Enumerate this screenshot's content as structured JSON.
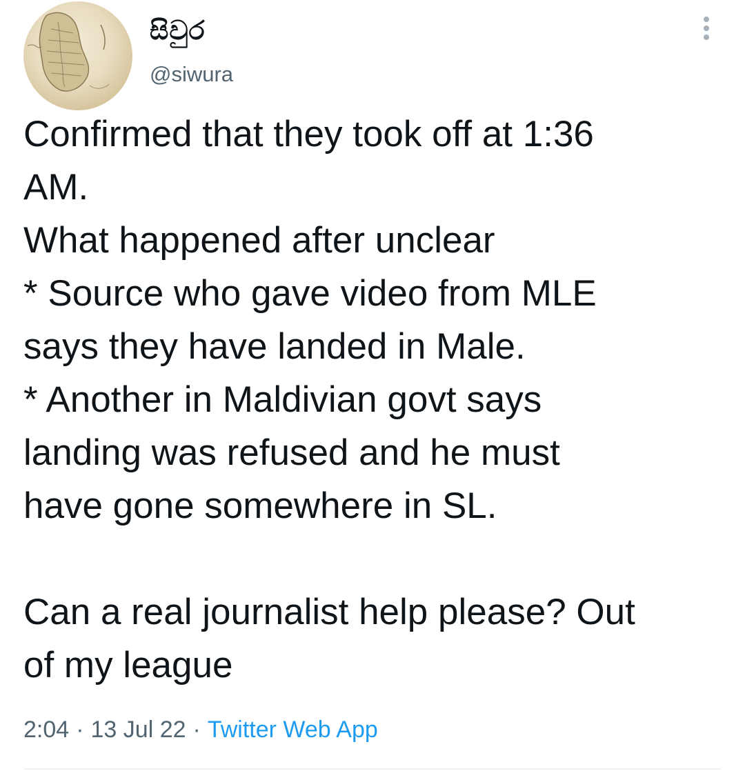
{
  "tweet": {
    "display_name": "සිවුර",
    "handle": "@siwura",
    "body": "Confirmed that they took off at 1:36\nAM.\nWhat happened after unclear\n* Source who gave video from MLE\nsays they have landed in Male.\n* Another in Maldivian govt says\nlanding was refused and he must\nhave gone somewhere in SL.\n\nCan a real journalist help please? Out\nof my league",
    "time": "2:04",
    "date": "13 Jul 22",
    "source": "Twitter Web App",
    "separator": "·"
  },
  "icons": {
    "avatar": "old-map-avatar-image",
    "more": "more-vertical-icon"
  },
  "colors": {
    "text": "#0f1419",
    "secondary": "#536471",
    "link": "#1d9bf0",
    "divider": "#eff3f4"
  }
}
